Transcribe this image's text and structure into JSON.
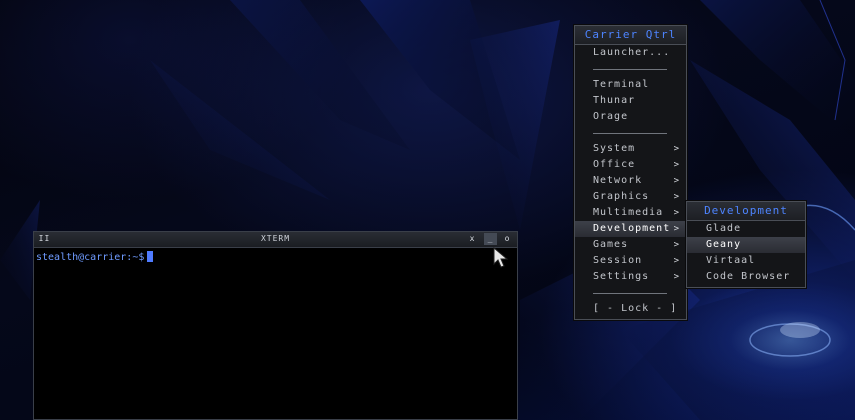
{
  "xterm": {
    "title": "XTERM",
    "pause_label": "II",
    "close_label": "x",
    "minimize_label": "_",
    "maximize_label": "o",
    "prompt": "stealth@carrier:~$"
  },
  "main_menu": {
    "title": "Carrier Qtrl",
    "launcher": "Launcher...",
    "apps": [
      "Terminal",
      "Thunar",
      "Orage"
    ],
    "categories": [
      "System",
      "Office",
      "Network",
      "Graphics",
      "Multimedia",
      "Development",
      "Games",
      "Session",
      "Settings"
    ],
    "submenu_arrow": ">",
    "active_category": "Development",
    "lock": "[ - Lock - ]"
  },
  "submenu": {
    "title": "Development",
    "items": [
      "Glade",
      "Geany",
      "Virtaal",
      "Code Browser"
    ],
    "highlighted": "Geany"
  },
  "colors": {
    "accent": "#4d84ff",
    "menu_bg": "#141518",
    "menu_text": "#c3c6cc"
  }
}
